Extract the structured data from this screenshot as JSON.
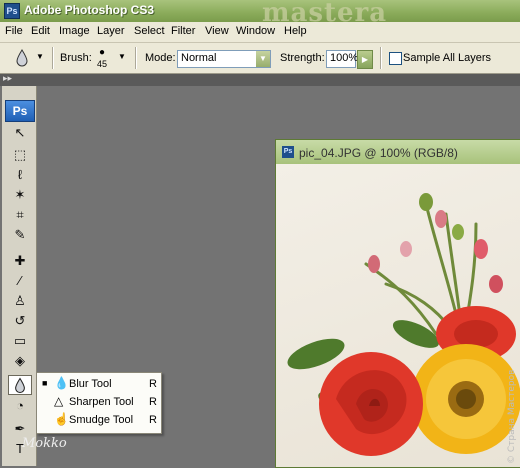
{
  "titlebar": {
    "app_title": "Adobe Photoshop CS3",
    "icon": "Ps",
    "watermark": "mastera rukodeliya.ru"
  },
  "menu": [
    "File",
    "Edit",
    "Image",
    "Layer",
    "Select",
    "Filter",
    "View",
    "Window",
    "Help"
  ],
  "options": {
    "brush_label": "Brush:",
    "brush_size": "45",
    "mode_label": "Mode:",
    "mode_value": "Normal",
    "strength_label": "Strength:",
    "strength_value": "100%",
    "sample_all_label": "Sample All Layers",
    "sample_all_checked": false
  },
  "toolbox": {
    "logo": "Ps",
    "tools": [
      "move-icon",
      "marquee-icon",
      "lasso-icon",
      "magic-wand-icon",
      "crop-icon",
      "slice-icon",
      "healing-brush-icon",
      "brush-icon",
      "clone-stamp-icon",
      "history-brush-icon",
      "eraser-icon",
      "paint-bucket-icon",
      "blur-icon",
      "dodge-icon",
      "pen-icon",
      "type-icon"
    ],
    "selected": "blur-icon"
  },
  "flyout": {
    "items": [
      {
        "label": "Blur Tool",
        "shortcut": "R",
        "icon": "blur-icon",
        "active": true
      },
      {
        "label": "Sharpen Tool",
        "shortcut": "R",
        "icon": "sharpen-icon",
        "active": false
      },
      {
        "label": "Smudge Tool",
        "shortcut": "R",
        "icon": "smudge-icon",
        "active": false
      }
    ]
  },
  "overlay_signature": "Mokko",
  "document": {
    "title": "pic_04.JPG @ 100% (RGB/8)"
  },
  "colors": {
    "title_green": "#8aab5a",
    "chrome": "#ece9d8",
    "workspace": "#737373",
    "accent_red": "#e0382a",
    "accent_yellow": "#f2b417"
  }
}
